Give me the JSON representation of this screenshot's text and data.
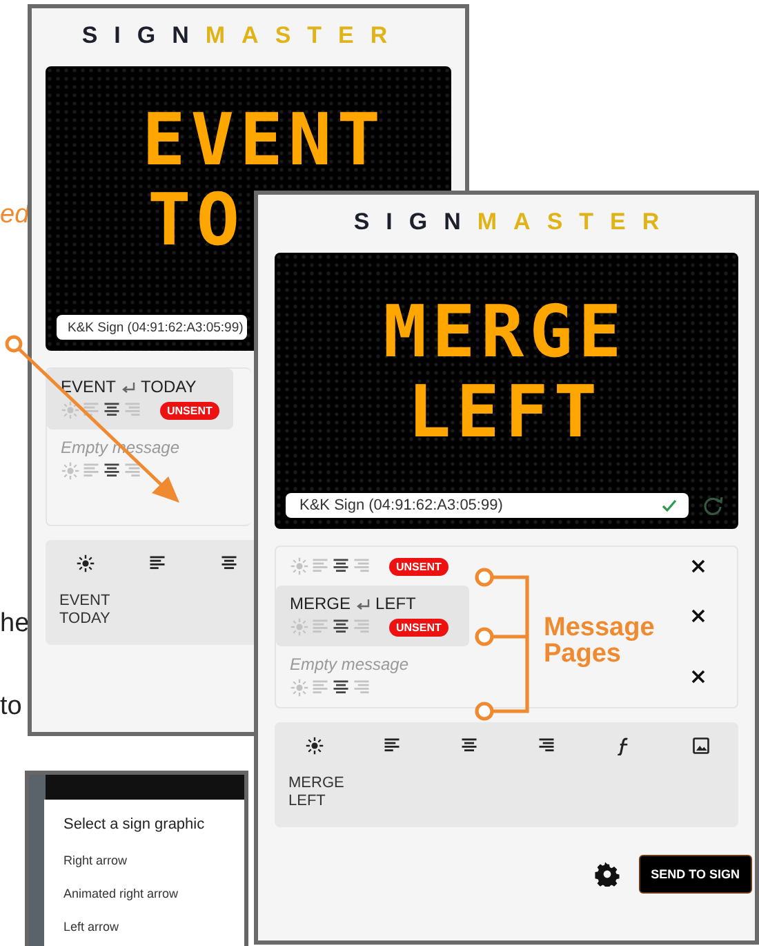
{
  "annotations": {
    "fragments": [
      {
        "text": "ed",
        "kind": "accent"
      },
      {
        "text": "he",
        "kind": "plain"
      },
      {
        "text": "to",
        "kind": "plain"
      }
    ],
    "callout": "Message Pages"
  },
  "screens": [
    {
      "logo": {
        "dark": "SIGN",
        "gold": "MASTER"
      },
      "display": {
        "lines": [
          "EVENT",
          "TO"
        ]
      },
      "device": {
        "name": "K&K Sign (04:91:62:A3:05:99)"
      },
      "messages": [
        {
          "lines": [
            "EVENT",
            "TODAY"
          ],
          "align": [
            {
              "selected": false
            },
            {
              "selected": true
            },
            {
              "selected": false
            }
          ],
          "badge": "UNSENT",
          "selected": true
        },
        {
          "placeholder": "Empty message",
          "align": [
            {
              "selected": false
            },
            {
              "selected": true
            },
            {
              "selected": false
            }
          ],
          "selected": false
        }
      ],
      "tools": [
        {
          "kind": "effects"
        },
        {
          "kind": "align_left"
        },
        {
          "kind": "align_center"
        }
      ],
      "editor_lines": [
        "EVENT",
        "TODAY"
      ]
    },
    {
      "logo": {
        "dark": "SIGN",
        "gold": "MASTER"
      },
      "display": {
        "lines": [
          "MERGE",
          "LEFT"
        ]
      },
      "device": {
        "name": "K&K Sign (04:91:62:A3:05:99)",
        "connected": true
      },
      "messages": [
        {
          "align": [
            {
              "selected": false
            },
            {
              "selected": true
            },
            {
              "selected": false
            }
          ],
          "badge": "UNSENT",
          "selected": false
        },
        {
          "lines": [
            "MERGE",
            "LEFT"
          ],
          "align": [
            {
              "selected": false
            },
            {
              "selected": true
            },
            {
              "selected": false
            }
          ],
          "badge": "UNSENT",
          "selected": true
        },
        {
          "placeholder": "Empty message",
          "align": [
            {
              "selected": false
            },
            {
              "selected": true
            },
            {
              "selected": false
            }
          ],
          "selected": false
        }
      ],
      "tools": [
        {
          "kind": "effects"
        },
        {
          "kind": "align_left"
        },
        {
          "kind": "align_center"
        },
        {
          "kind": "align_right"
        },
        {
          "kind": "font"
        },
        {
          "kind": "image"
        }
      ],
      "editor_lines": [
        "MERGE",
        "LEFT"
      ],
      "send_button": "SEND TO SIGN"
    }
  ],
  "graphic_dialog": {
    "title": "Select a sign graphic",
    "options": [
      "Right arrow",
      "Animated right arrow",
      "Left arrow"
    ]
  }
}
